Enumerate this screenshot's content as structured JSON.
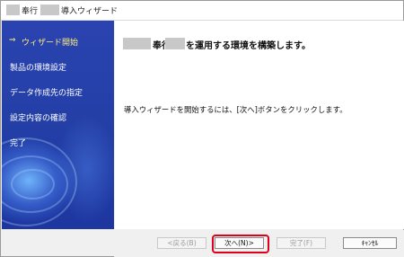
{
  "window": {
    "title_prefix": "奉行",
    "title_suffix": "導入ウィザード"
  },
  "sidebar": {
    "arrow": "⇒",
    "items": [
      {
        "label": "ウィザード開始",
        "active": true
      },
      {
        "label": "製品の環境設定",
        "active": false
      },
      {
        "label": "データ作成先の指定",
        "active": false
      },
      {
        "label": "設定内容の確認",
        "active": false
      },
      {
        "label": "完了",
        "active": false
      }
    ]
  },
  "main": {
    "heading_product": "奉行",
    "heading_rest": "を運用する環境を構築します。",
    "instruction": "導入ウィザードを開始するには、[次へ]ボタンをクリックします。"
  },
  "buttons": {
    "back": "<戻る(B)",
    "next": "次へ(N)>",
    "finish": "完了(F)",
    "cancel": "ｷｬﾝｾﾙ"
  },
  "colors": {
    "sidebar_bg": "#2440a7",
    "active_item": "#ffef7a",
    "highlight": "#e0001b"
  }
}
